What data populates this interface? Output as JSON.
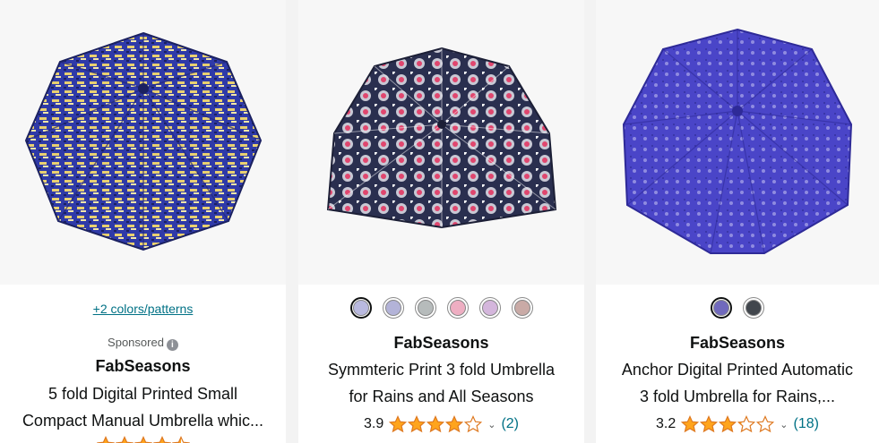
{
  "cards": [
    {
      "colors_link": "+2 colors/patterns",
      "sponsored": "Sponsored",
      "brand": "FabSeasons",
      "title_line1": "5 fold Digital Printed Small",
      "title_line2": "Compact Manual Umbrella whic...",
      "image_colors": [
        "#2f3aa8",
        "#e8d070"
      ],
      "stars": 4.5
    },
    {
      "brand": "FabSeasons",
      "title_line1": "Symmteric Print 3 fold Umbrella",
      "title_line2": "for Rains and All Seasons",
      "rating": "3.9",
      "stars": 3.9,
      "review_count": "(2)",
      "swatches": [
        "#b9b9df",
        "#b3b3d8",
        "#b6bbbb",
        "#eeaec2",
        "#d4b6dc",
        "#c9aaa6"
      ],
      "image_colors": [
        "#2a2f4f",
        "#e0466e"
      ]
    },
    {
      "brand": "FabSeasons",
      "title_line1": "Anchor Digital Printed Automatic",
      "title_line2": "3 fold Umbrella for Rains,...",
      "rating": "3.2",
      "stars": 3.2,
      "review_count": "(18)",
      "swatches": [
        "#7069bd",
        "#41464d"
      ],
      "image_colors": [
        "#4a45c8",
        "#8f8be0"
      ]
    }
  ],
  "colors": {
    "star": "#ffa41c",
    "link": "#007185"
  }
}
